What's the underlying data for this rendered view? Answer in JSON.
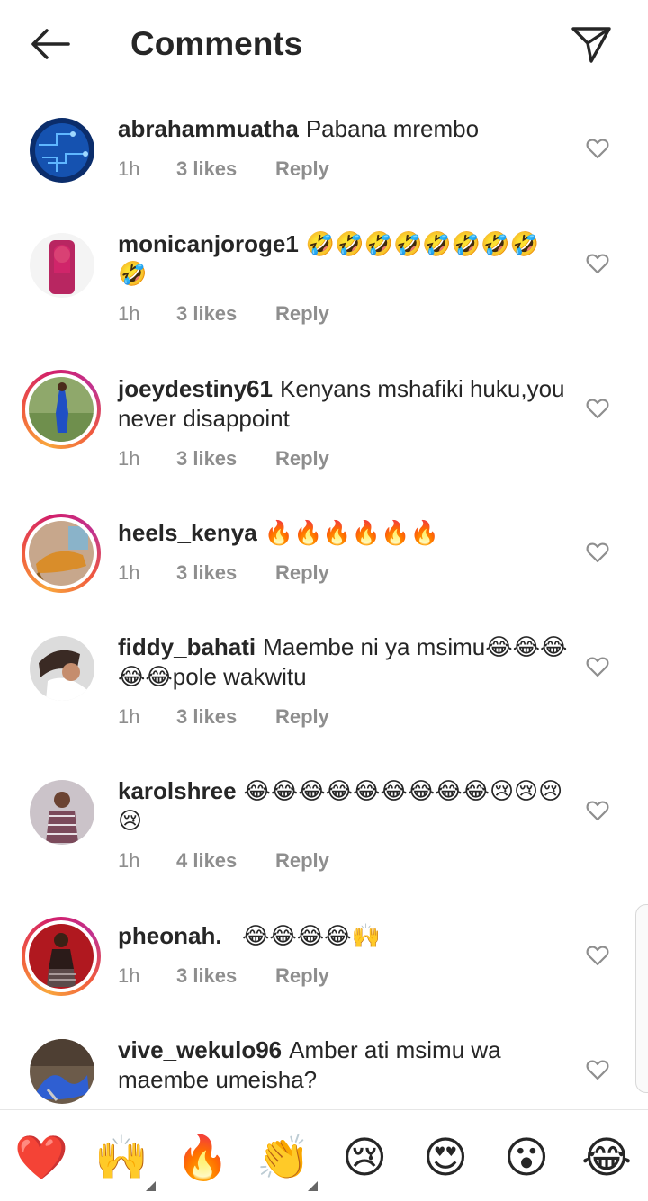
{
  "header": {
    "title": "Comments",
    "back_icon": "arrow-left-icon",
    "send_icon": "paper-plane-icon"
  },
  "comments": [
    {
      "username": "abrahammuatha",
      "text": "Pabana mrembo",
      "time": "1h",
      "likes": "3 likes",
      "reply": "Reply"
    },
    {
      "username": "monicanjoroge1",
      "text": "🤣🤣🤣🤣🤣🤣🤣🤣🤣",
      "time": "1h",
      "likes": "3 likes",
      "reply": "Reply"
    },
    {
      "username": "joeydestiny61",
      "text": "Kenyans mshafiki huku,you never disappoint",
      "time": "1h",
      "likes": "3 likes",
      "reply": "Reply"
    },
    {
      "username": "heels_kenya",
      "text": "🔥🔥🔥🔥🔥🔥",
      "time": "1h",
      "likes": "3 likes",
      "reply": "Reply"
    },
    {
      "username": "fiddy_bahati",
      "text": "Maembe ni ya msimu😂😂😂😂😂pole wakwitu",
      "time": "1h",
      "likes": "3 likes",
      "reply": "Reply"
    },
    {
      "username": "karolshree",
      "text": "😂😂😂😂😂😂😂😂😂😢😢😢😢",
      "time": "1h",
      "likes": "4 likes",
      "reply": "Reply"
    },
    {
      "username": "pheonah._",
      "text": "😂😂😂😂🙌",
      "time": "1h",
      "likes": "3 likes",
      "reply": "Reply"
    },
    {
      "username": "vive_wekulo96",
      "text": "Amber ati msimu wa maembe umeisha?",
      "time": "",
      "likes": "",
      "reply": ""
    }
  ],
  "reactions": [
    "❤️",
    "🙌",
    "🔥",
    "👏",
    "😢",
    "😍",
    "😮",
    "😂"
  ],
  "colors": {
    "text": "#262626",
    "meta": "#8e8e8e",
    "story_ring_start": "#f9a63c",
    "story_ring_end": "#c2338e",
    "heart_outline": "#8e8e8e"
  }
}
